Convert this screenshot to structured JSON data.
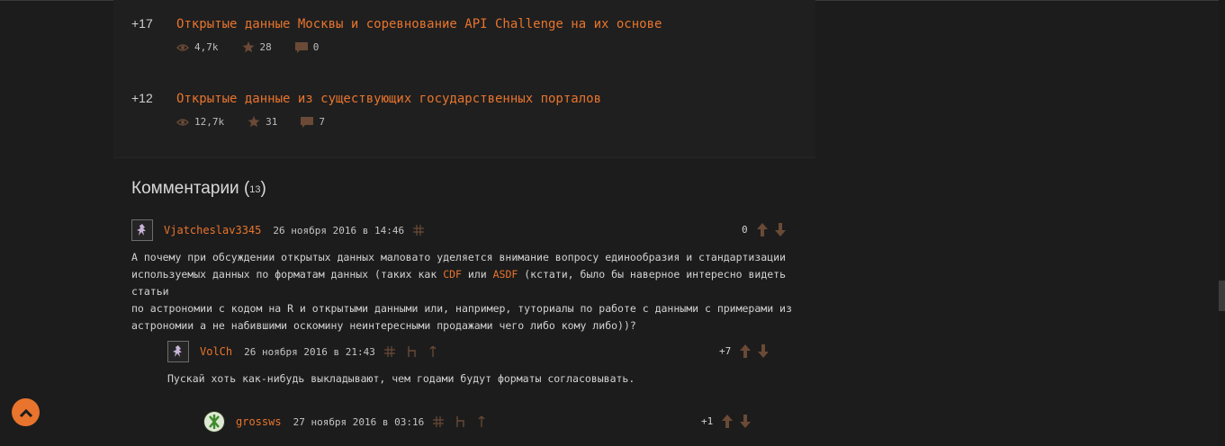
{
  "posts": [
    {
      "score": "+17",
      "title": "Открытые данные Москвы и соревнование API Challenge на их основе",
      "views": "4,7k",
      "bookmarks": "28",
      "comments": "0"
    },
    {
      "score": "+12",
      "title": "Открытые данные из существующих государственных порталов",
      "views": "12,7k",
      "bookmarks": "31",
      "comments": "7"
    }
  ],
  "comments_section": {
    "title": "Комментарии",
    "count": "13"
  },
  "comments": [
    {
      "user": "Vjatcheslav3345",
      "date": "26 ноября 2016 в 14:46",
      "score": "0",
      "text_part1": "А почему при обсуждении открытых данных маловато уделяется внимание вопросу единообразия и стандартизации\nиспользуемых данных по форматам данных (таких как ",
      "link1": "CDF",
      "text_part2": " или ",
      "link2": "ASDF",
      "text_part3": " (кстати, было бы наверное интересно видеть статьи\nпо астрономии с кодом на R и открытыми данными или, например, туториалы по работе с данными с примерами из\nастрономии а не набившими оскомину неинтересными продажами чего либо кому либо))?"
    },
    {
      "user": "VolCh",
      "date": "26 ноября 2016 в 21:43",
      "score": "+7",
      "text": "Пускай хоть как-нибудь выкладывают, чем годами будут форматы согласовывать."
    },
    {
      "user": "grossws",
      "date": "27 ноября 2016 в 03:16",
      "score": "+1"
    }
  ],
  "colors": {
    "accent": "#e8742d",
    "background": "#1c1c1c",
    "panel": "#1f1f1f"
  },
  "icons": [
    "eye-icon",
    "star-icon",
    "comment-icon",
    "hash-icon",
    "parent-icon",
    "up-icon",
    "vote-up-icon",
    "vote-down-icon",
    "scroll-top-icon"
  ]
}
